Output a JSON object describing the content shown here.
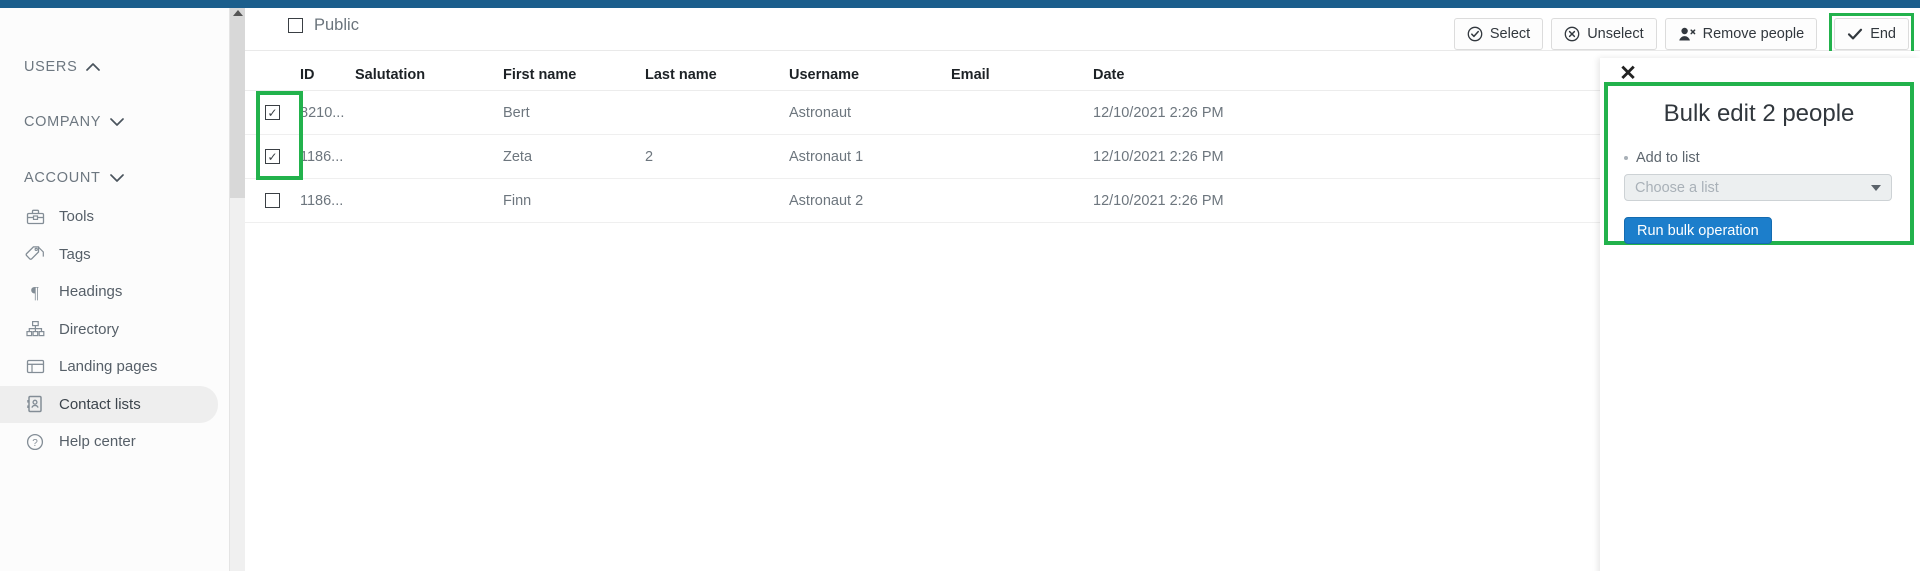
{
  "topbar": {
    "color": "#1b5e8c"
  },
  "sidebar": {
    "groups": [
      {
        "label": "USERS",
        "icon": "chevron-up-icon",
        "expanded": true
      },
      {
        "label": "COMPANY",
        "icon": "chevron-down-icon",
        "expanded": false
      },
      {
        "label": "ACCOUNT",
        "icon": "chevron-down-icon",
        "expanded": false
      }
    ],
    "items": [
      {
        "label": "Tools",
        "icon": "toolbox-icon",
        "active": false
      },
      {
        "label": "Tags",
        "icon": "tag-icon",
        "active": false
      },
      {
        "label": "Headings",
        "icon": "pilcrow-icon",
        "active": false
      },
      {
        "label": "Directory",
        "icon": "sitemap-icon",
        "active": false
      },
      {
        "label": "Landing pages",
        "icon": "window-icon",
        "active": false
      },
      {
        "label": "Contact lists",
        "icon": "address-book-icon",
        "active": true
      },
      {
        "label": "Help center",
        "icon": "question-circle-icon",
        "active": false
      }
    ]
  },
  "header": {
    "public_label": "Public",
    "public_checked": false,
    "actions": [
      {
        "label": "Select",
        "icon": "check-circle-icon",
        "highlighted": false
      },
      {
        "label": "Unselect",
        "icon": "times-circle-icon",
        "highlighted": false
      },
      {
        "label": "Remove people",
        "icon": "user-remove-icon",
        "highlighted": false
      },
      {
        "label": "End",
        "icon": "check-icon",
        "highlighted": true
      }
    ]
  },
  "table": {
    "columns": [
      "ID",
      "Salutation",
      "First name",
      "Last name",
      "Username",
      "Email",
      "Date"
    ],
    "settings_icon": "gear-icon",
    "rows": [
      {
        "checked": true,
        "id": "8210...",
        "salutation": "",
        "first_name": "Bert",
        "last_name": "",
        "username": "Astronaut",
        "email": "",
        "date": "12/10/2021 2:26 PM"
      },
      {
        "checked": true,
        "id": "1186...",
        "salutation": "",
        "first_name": "Zeta",
        "last_name": "2",
        "username": "Astronaut 1",
        "email": "",
        "date": "12/10/2021 2:26 PM"
      },
      {
        "checked": false,
        "id": "1186...",
        "salutation": "",
        "first_name": "Finn",
        "last_name": "",
        "username": "Astronaut 2",
        "email": "",
        "date": "12/10/2021 2:26 PM"
      }
    ]
  },
  "panel": {
    "close_icon": "close-icon",
    "title": "Bulk edit 2 people",
    "field_label": "Add to list",
    "select_placeholder": "Choose a list",
    "run_button": "Run bulk operation"
  },
  "colors": {
    "highlight": "#22b24c",
    "primary_button": "#1c7ecb",
    "topbar": "#1b5e8c"
  }
}
